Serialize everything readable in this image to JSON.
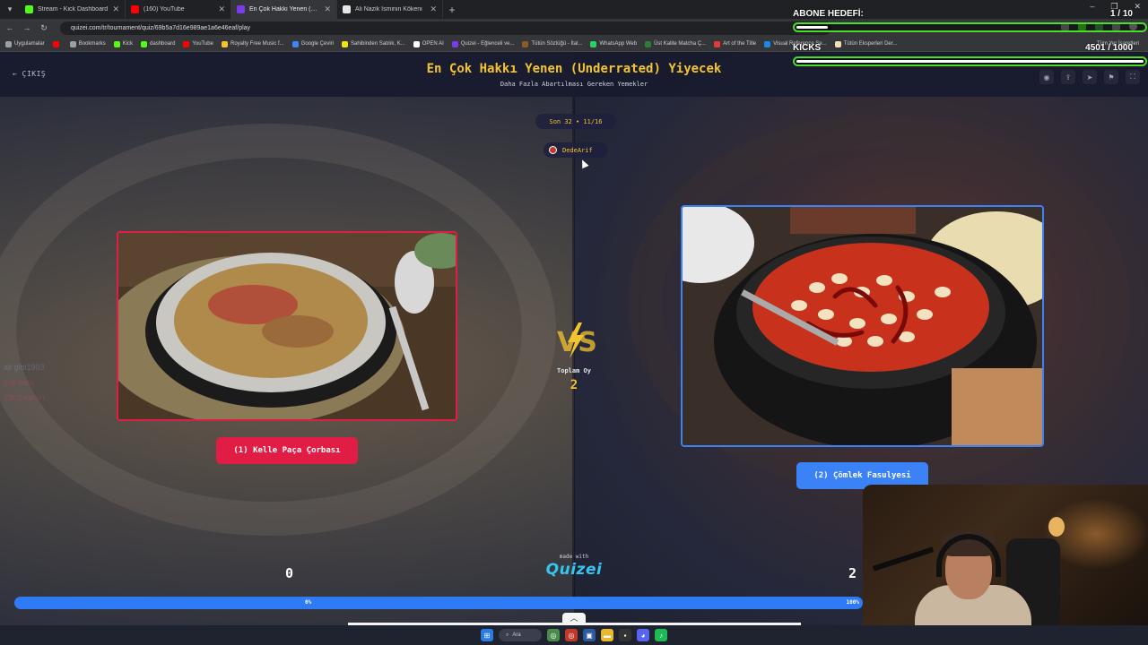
{
  "browser": {
    "tabs": [
      {
        "title": "Stream - Kick Dashboard",
        "color": "#53fc18"
      },
      {
        "title": "(160) YouTube",
        "color": "#ff0000"
      },
      {
        "title": "En Çok Hakkı Yenen (Underrated)",
        "color": "#7c3aed"
      },
      {
        "title": "Ali Nazik İsminin Kökeni",
        "color": "#e5e5e5"
      }
    ],
    "url": "quizei.com/tr/tournament/quiz/69b5a7d16e989ae1a6e46eaf/play",
    "bookmarks": [
      {
        "label": "Uygulamalar",
        "color": "#9aa0a6"
      },
      {
        "label": "",
        "color": "#ff0000"
      },
      {
        "label": "Bookmarks",
        "color": "#9aa0a6"
      },
      {
        "label": "Kick",
        "color": "#53fc18"
      },
      {
        "label": "dashboard",
        "color": "#53fc18"
      },
      {
        "label": "YouTube",
        "color": "#ff0000"
      },
      {
        "label": "Royalty Free Music f...",
        "color": "#f4c430"
      },
      {
        "label": "Google Çeviri",
        "color": "#4285f4"
      },
      {
        "label": "Sahibinden Satılık, K...",
        "color": "#f4e409"
      },
      {
        "label": "OPEN AI",
        "color": "#ffffff"
      },
      {
        "label": "Quizei - Eğlenceli ve...",
        "color": "#7c3aed"
      },
      {
        "label": "Tütün Sözlüğü - İtal...",
        "color": "#8b5a2b"
      },
      {
        "label": "WhatsApp Web",
        "color": "#25d366"
      },
      {
        "label": "Üst Kalite Matcha Ç...",
        "color": "#2e7d32"
      },
      {
        "label": "Art of the Title",
        "color": "#e53935"
      },
      {
        "label": "Visual Reference Se...",
        "color": "#1e88e5"
      },
      {
        "label": "Tütün Eksperleri Der...",
        "color": "#f5deb3"
      }
    ],
    "other_bookmarks": "Tüm Yer İşaretleri"
  },
  "quiz": {
    "exit_label": "← ÇIKIŞ",
    "title": "En Çok Hakkı Yenen (Underrated) Yiyecek",
    "subtitle": "Daha Fazla Abartılması Gereken Yemekler",
    "round": "Son 32 • 11/16",
    "username": "DedeArif",
    "option_left": "(1) Kelle Paça Çorbası",
    "option_right": "(2) Çömlek Fasulyesi",
    "total_label": "Toplam Oy",
    "total_votes": "2",
    "score_left": "0",
    "score_right": "2",
    "made_with": "made with",
    "logo": "Quizei",
    "progress_left_label": "0%",
    "progress_right_label": "100%",
    "progress_left_fraction": 0.0,
    "colors": {
      "accent": "#f4c430",
      "left": "#e21d45",
      "right": "#3b82f6"
    }
  },
  "overlay": {
    "sub_goal_label": "ABONE HEDEFİ:",
    "sub_goal_value": "1 / 10",
    "sub_goal_fraction": 0.1,
    "kicks_label": "KICKS",
    "kicks_value": "4501  / 1000",
    "kicks_fraction": 1.0
  },
  "chat": [
    {
      "text": "ali gitti1903",
      "class": "b"
    },
    {
      "text": "çok fena",
      "class": "r"
    },
    {
      "text": "1903 kalsin",
      "class": "r"
    }
  ],
  "taskbar": {
    "search": "Ara"
  }
}
